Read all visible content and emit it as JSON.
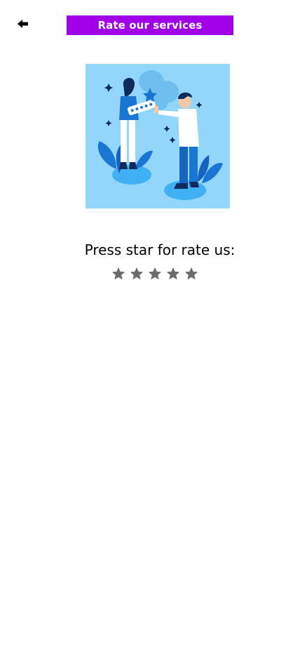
{
  "header": {
    "back_icon": "arrow-left-icon",
    "title": "Rate our services",
    "title_bg": "#a100e6"
  },
  "illustration": {
    "bg": "#92d6fb"
  },
  "rating": {
    "prompt": "Press star for rate us:",
    "star_icon": "star-icon",
    "star_color": "#6b6b6b",
    "max_stars": 5,
    "current_rating": 0
  }
}
